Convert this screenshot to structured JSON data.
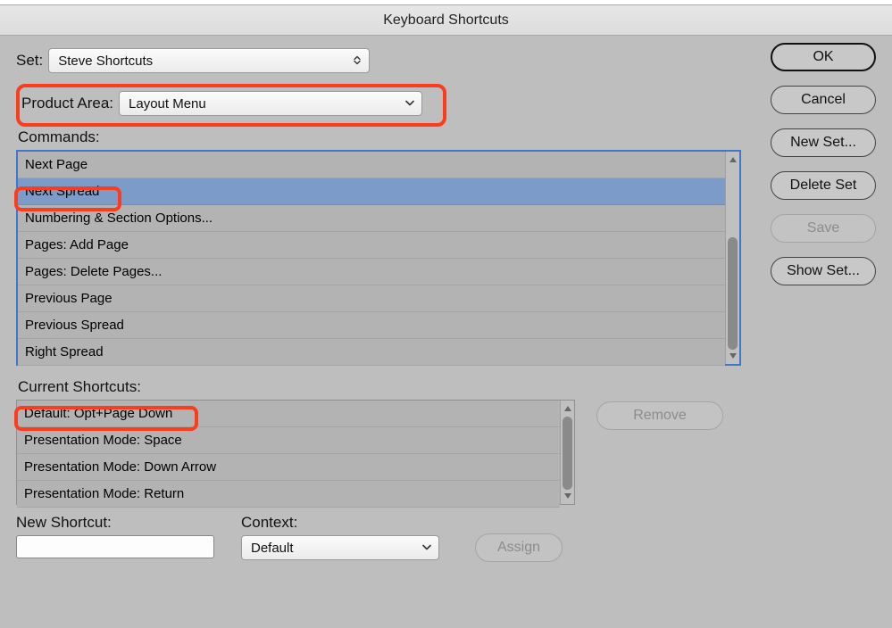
{
  "title": "Keyboard Shortcuts",
  "set": {
    "label": "Set:",
    "value": "Steve Shortcuts"
  },
  "product_area": {
    "label": "Product Area:",
    "value": "Layout Menu"
  },
  "commands": {
    "label": "Commands:",
    "items": [
      "Next Page",
      "Next Spread",
      "Numbering & Section Options...",
      "Pages: Add Page",
      "Pages: Delete Pages...",
      "Previous Page",
      "Previous Spread",
      "Right Spread"
    ],
    "selected_index": 1
  },
  "current_shortcuts": {
    "label": "Current Shortcuts:",
    "items": [
      "Default: Opt+Page Down",
      "Presentation Mode: Space",
      "Presentation Mode: Down Arrow",
      "Presentation Mode: Return"
    ]
  },
  "new_shortcut": {
    "label": "New Shortcut:",
    "value": ""
  },
  "context": {
    "label": "Context:",
    "value": "Default"
  },
  "buttons": {
    "ok": "OK",
    "cancel": "Cancel",
    "new_set": "New Set...",
    "delete_set": "Delete Set",
    "save": "Save",
    "show_set": "Show Set...",
    "remove": "Remove",
    "assign": "Assign"
  }
}
